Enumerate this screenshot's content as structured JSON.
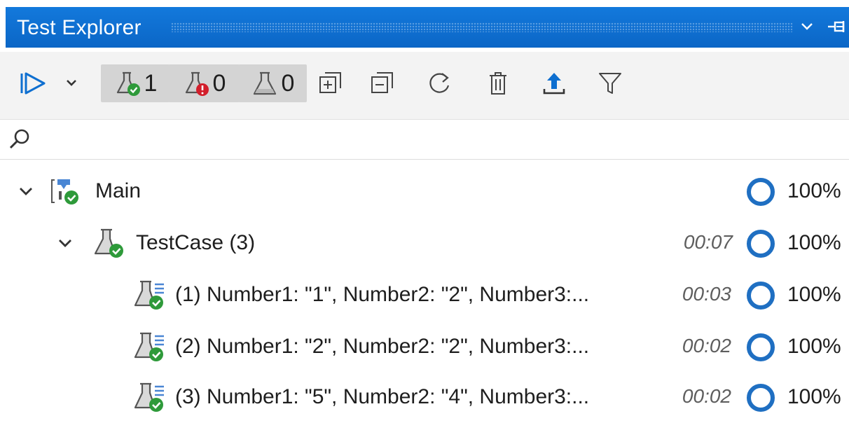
{
  "window": {
    "title": "Test Explorer"
  },
  "toolbar": {
    "run_button": "run-all-icon",
    "counters": [
      {
        "name": "passed",
        "count": "1",
        "color": "#2e9a3a"
      },
      {
        "name": "failed",
        "count": "0",
        "color": "#d21e2b"
      },
      {
        "name": "not_run",
        "count": "0",
        "color": "#6b6b6b"
      }
    ],
    "accent_color": "#0e6fd0"
  },
  "search": {
    "value": "",
    "placeholder": ""
  },
  "tree": [
    {
      "level": 0,
      "label": "Main",
      "duration": "",
      "coverage": "100%",
      "expanded": true
    },
    {
      "level": 1,
      "label": "TestCase (3)",
      "duration": "00:07",
      "coverage": "100%",
      "expanded": true
    },
    {
      "level": 2,
      "label": "(1) Number1: \"1\", Number2: \"2\", Number3:...",
      "duration": "00:03",
      "coverage": "100%"
    },
    {
      "level": 2,
      "label": "(2) Number1: \"2\", Number2: \"2\", Number3:...",
      "duration": "00:02",
      "coverage": "100%"
    },
    {
      "level": 2,
      "label": "(3) Number1: \"5\", Number2: \"4\", Number3:...",
      "duration": "00:02",
      "coverage": "100%"
    }
  ]
}
